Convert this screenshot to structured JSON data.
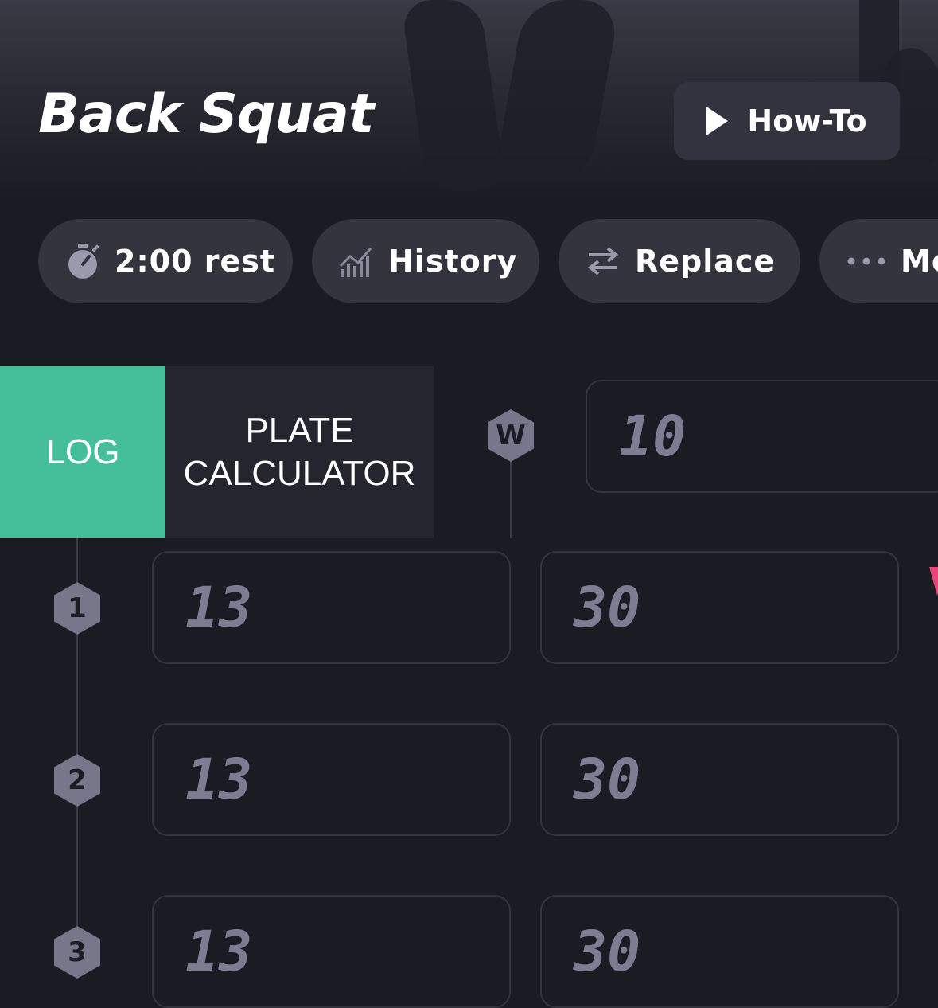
{
  "exercise": {
    "title": "Back Squat",
    "howto_label": "How-To"
  },
  "actions": [
    {
      "icon": "stopwatch-icon",
      "label": "2:00 rest"
    },
    {
      "icon": "chart-icon",
      "label": "History"
    },
    {
      "icon": "swap-arrows-icon",
      "label": "Replace"
    },
    {
      "icon": "more-dots-icon",
      "label": "More"
    }
  ],
  "tabs": {
    "log": "LOG",
    "plate": "PLATE\nCALCULATOR"
  },
  "warmup": {
    "badge": "W",
    "value": "10"
  },
  "sets": [
    {
      "badge": "1",
      "weight": "13",
      "reps": "30"
    },
    {
      "badge": "2",
      "weight": "13",
      "reps": "30"
    },
    {
      "badge": "3",
      "weight": "13",
      "reps": "30"
    }
  ],
  "colors": {
    "accent": "#45bf97",
    "background": "#1b1b24",
    "chip": "#34343f",
    "pink": "#e8457a"
  }
}
